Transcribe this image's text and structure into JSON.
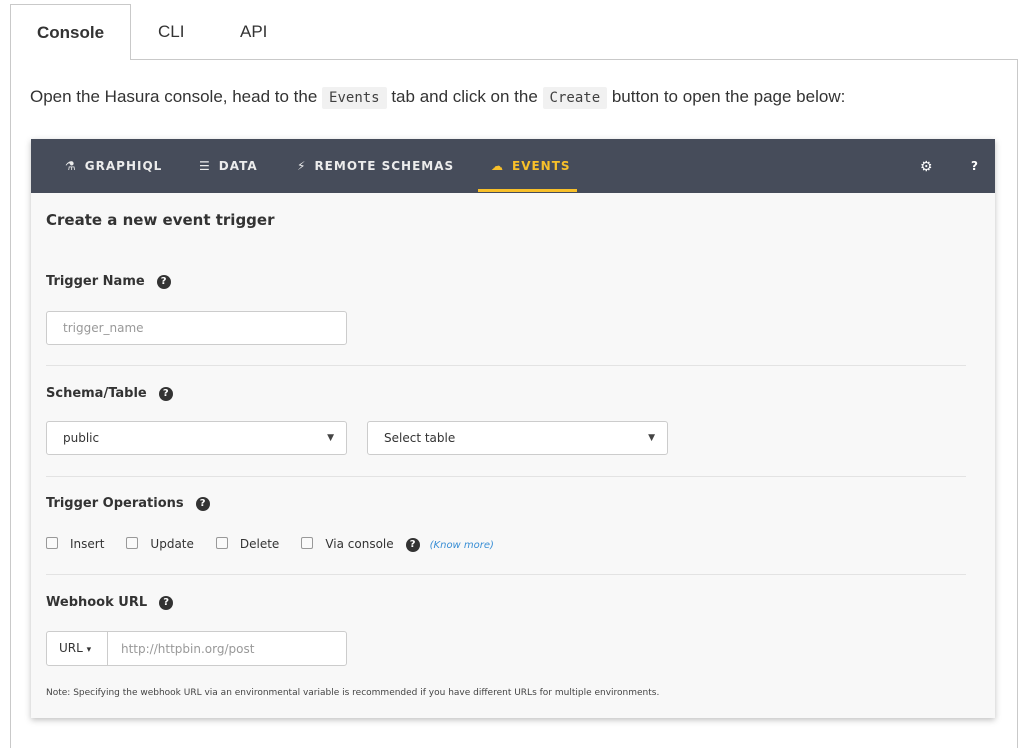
{
  "doc_tabs": [
    "Console",
    "CLI",
    "API"
  ],
  "intro": {
    "before": "Open the Hasura console, head to the ",
    "code1": "Events",
    "middle": " tab and click on the ",
    "code2": "Create",
    "after": " button to open the page below:"
  },
  "console": {
    "nav": [
      {
        "label": "GRAPHIQL",
        "icon": "flask-icon"
      },
      {
        "label": "DATA",
        "icon": "database-icon"
      },
      {
        "label": "REMOTE SCHEMAS",
        "icon": "plug-icon"
      },
      {
        "label": "EVENTS",
        "icon": "cloud-icon",
        "active": true
      }
    ],
    "settings_icon": "gear-icon",
    "help_label": "?",
    "title": "Create a new event trigger",
    "trigger_name": {
      "label": "Trigger Name",
      "placeholder": "trigger_name"
    },
    "schema_table": {
      "label": "Schema/Table",
      "schema_value": "public",
      "table_value": "Select table"
    },
    "trigger_operations": {
      "label": "Trigger Operations",
      "options": [
        "Insert",
        "Update",
        "Delete",
        "Via console"
      ],
      "know_more": "(Know more)"
    },
    "webhook": {
      "label": "Webhook URL",
      "type_button": "URL",
      "placeholder": "http://httpbin.org/post",
      "note": "Note: Specifying the webhook URL via an environmental variable is recommended if you have different URLs for multiple environments."
    }
  },
  "colors": {
    "navbar": "#464c5a",
    "active": "#f8c02a",
    "link": "#3a8fd5"
  }
}
